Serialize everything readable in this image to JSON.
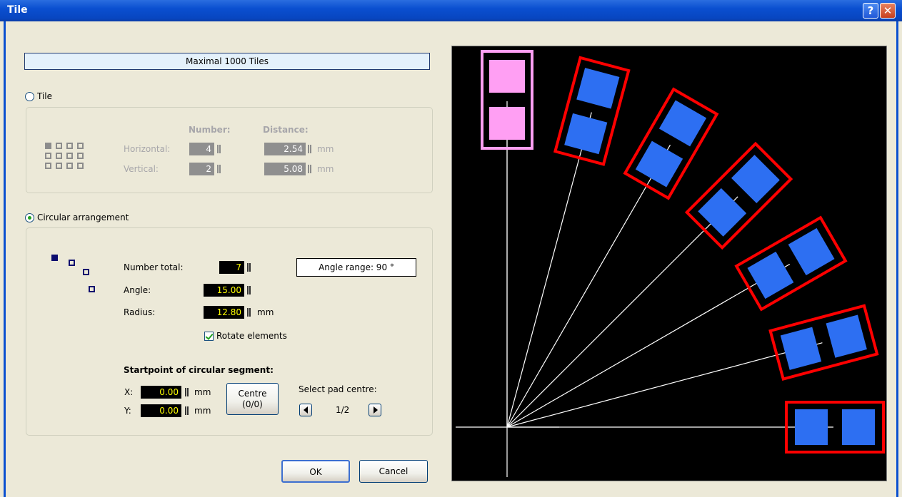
{
  "window": {
    "title": "Tile",
    "help_label": "?",
    "close_label": "✕"
  },
  "banner": "Maximal 1000 Tiles",
  "tile_option": {
    "label": "Tile",
    "selected": false,
    "number_header": "Number:",
    "distance_header": "Distance:",
    "horizontal": {
      "label": "Horizontal:",
      "number": "4",
      "distance": "2.54",
      "unit": "mm"
    },
    "vertical": {
      "label": "Vertical:",
      "number": "2",
      "distance": "5.08",
      "unit": "mm"
    }
  },
  "circular_option": {
    "label": "Circular arrangement",
    "selected": true,
    "number_total": {
      "label": "Number total:",
      "value": "7"
    },
    "angle": {
      "label": "Angle:",
      "value": "15.00"
    },
    "radius": {
      "label": "Radius:",
      "value": "12.80",
      "unit": "mm"
    },
    "angle_range": "Angle range: 90 °",
    "rotate_elements": {
      "label": "Rotate elements",
      "checked": true
    },
    "startpoint": {
      "heading": "Startpoint of circular segment:",
      "x": {
        "label": "X:",
        "value": "0.00",
        "unit": "mm"
      },
      "y": {
        "label": "Y:",
        "value": "0.00",
        "unit": "mm"
      },
      "centre_button": [
        "Centre",
        "(0/0)"
      ]
    },
    "pad_centre": {
      "label": "Select pad centre:",
      "value": "1/2"
    }
  },
  "buttons": {
    "ok": "OK",
    "cancel": "Cancel"
  },
  "preview": {
    "colors": {
      "background": "#000000",
      "pad": "#2d6ff2",
      "highlight_pad": "#ff9ff3",
      "outline": "#ff0000",
      "highlight_outline": "#ff9ff3",
      "line": "#ffffff"
    },
    "element_count": 7,
    "angle_step_deg": 15,
    "highlighted_element": 1
  }
}
